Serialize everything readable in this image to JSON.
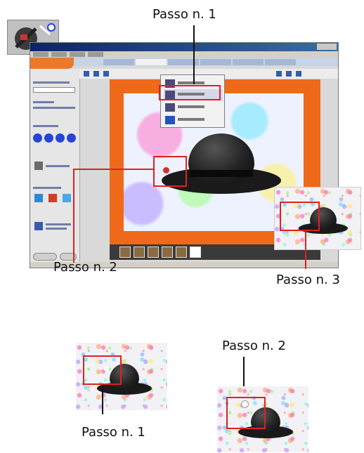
{
  "annotations": {
    "top_step": "Passo n. 1",
    "step2_left": "Passo n. 2",
    "step3": "Passo n. 3",
    "bottom_step1": "Passo n. 1",
    "bottom_step2": "Passo n. 2"
  },
  "colors": {
    "highlight": "#e02020",
    "accent_orange": "#ee6a1a",
    "palette_blue": "#2645d8",
    "title_bar": "#0a246a"
  },
  "icons": {
    "tool": "wizard-magic-wand-icon",
    "popup_items": [
      "image-icon",
      "sharpen-icon",
      "pencil-icon",
      "red-eye-icon"
    ]
  }
}
